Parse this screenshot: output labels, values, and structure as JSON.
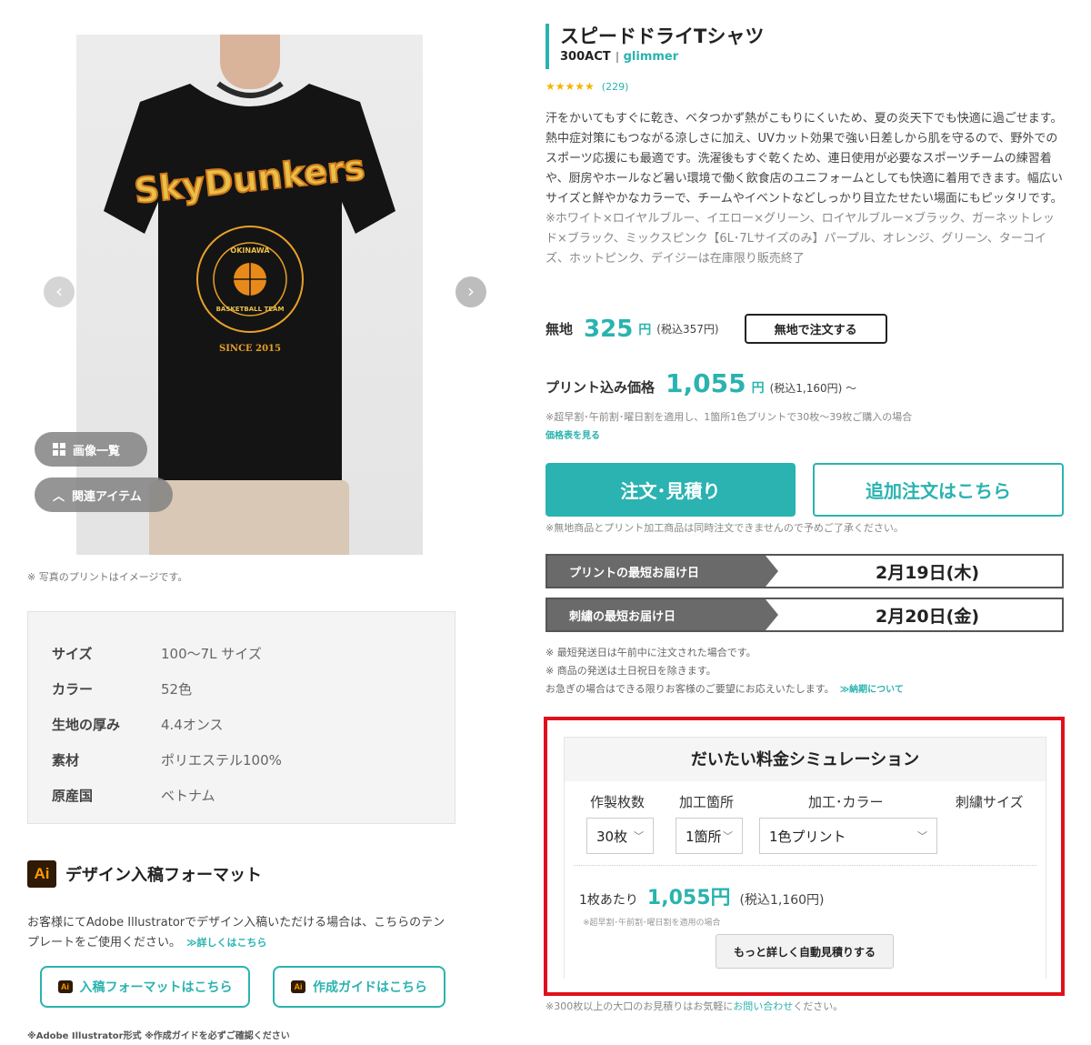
{
  "gallery": {
    "images_button": "画像一覧",
    "related_button": "関連アイテム",
    "photo_note": "※ 写真のプリントはイメージです。",
    "shirt_print": {
      "team": "SkyDunkers",
      "arc_top": "OKINAWA",
      "arc_bottom": "BASKETBALL TEAM",
      "since": "SINCE 2015"
    }
  },
  "specs": [
    {
      "label": "サイズ",
      "value": "100〜7L サイズ"
    },
    {
      "label": "カラー",
      "value": "52色"
    },
    {
      "label": "生地の厚み",
      "value": "4.4オンス"
    },
    {
      "label": "素材",
      "value": "ポリエステル100%"
    },
    {
      "label": "原産国",
      "value": "ベトナム"
    }
  ],
  "design": {
    "badge": "Ai",
    "title": "デザイン入稿フォーマット",
    "text": "お客様にてAdobe Illustratorでデザイン入稿いただける場合は、こちらのテンプレートをご使用ください。",
    "detail_link": "≫詳しくはこちら",
    "format_button": "入稿フォーマットはこちら",
    "guide_button": "作成ガイドはこちら",
    "footnote": "※Adobe Illustrator形式 ※作成ガイドを必ずご確認ください"
  },
  "product": {
    "name": "スピードドライTシャツ",
    "model": "300ACT",
    "brand": "glimmer",
    "stars": "★★★★★",
    "review_count": "(229)",
    "description": "汗をかいてもすぐに乾き、ベタつかず熱がこもりにくいため、夏の炎天下でも快適に過ごせます。熱中症対策にもつながる涼しさに加え、UVカット効果で強い日差しから肌を守るので、野外でのスポーツ応援にも最適です。洗濯後もすぐ乾くため、連日使用が必要なスポーツチームの練習着や、厨房やホールなど暑い環境で働く飲食店のユニフォームとしても快適に着用できます。幅広いサイズと鮮やかなカラーで、チームやイベントなどしっかり目立たせたい場面にもピッタリです。",
    "color_note": "※ホワイト×ロイヤルブルー、イエロー×グリーン、ロイヤルブルー×ブラック、ガーネットレッド×ブラック、ミックスピンク【6L･7Lサイズのみ】パープル、オレンジ、グリーン、ターコイズ、ホットピンク、デイジーは在庫限り販売終了"
  },
  "pricing": {
    "plain_label": "無地",
    "plain_price": "325",
    "yen": "円",
    "plain_tax": "(税込357円)",
    "plain_button": "無地で注文する",
    "print_label": "プリント込み価格",
    "print_price": "1,055",
    "print_tax": "(税込1,160円) 〜",
    "print_note": "※超早割･午前割･曜日割を適用し、1箇所1色プリントで30枚〜39枚ご購入の場合",
    "price_table_link": "価格表を見る"
  },
  "actions": {
    "order_button": "注文･見積り",
    "additional_button": "追加注文はこちら",
    "order_note": "※無地商品とプリント加工商品は同時注文できませんので予めご了承ください。"
  },
  "delivery": {
    "print_label": "プリントの最短お届け日",
    "print_date": "2月19日(木)",
    "embroidery_label": "刺繍の最短お届け日",
    "embroidery_date": "2月20日(金)",
    "note1": "※ 最短発送日は午前中に注文された場合です。",
    "note2": "※ 商品の発送は土日祝日を除きます。",
    "note3": "お急ぎの場合はできる限りお客様のご要望にお応えいたします。",
    "note3_link": "≫納期について"
  },
  "simulation": {
    "title": "だいたい料金シミュレーション",
    "col_qty": "作製枚数",
    "col_location": "加工箇所",
    "col_color": "加工･カラー",
    "col_embroidery": "刺繍サイズ",
    "qty_value": "30枚",
    "location_value": "1箇所",
    "color_value": "1色プリント",
    "unit_label": "1枚あたり",
    "unit_price": "1,055円",
    "unit_tax": "(税込1,160円)",
    "note": "※超早割･午前割･曜日割を適用の場合",
    "detail_button": "もっと詳しく自動見積りする"
  },
  "bulk": {
    "prefix": "※300枚以上の大口のお見積りはお気軽に",
    "link": "お問い合わせ",
    "suffix": "ください。"
  }
}
